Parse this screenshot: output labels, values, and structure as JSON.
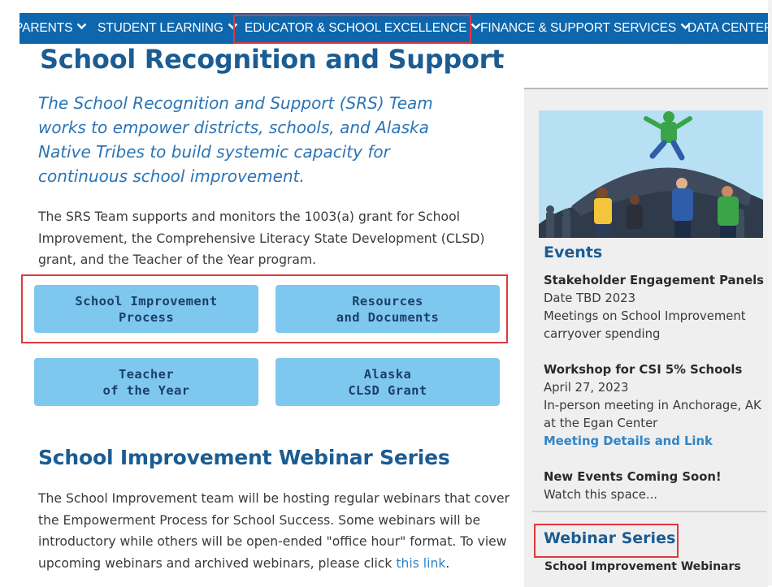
{
  "nav": {
    "items": [
      {
        "label": "PARENTS"
      },
      {
        "label": "STUDENT LEARNING"
      },
      {
        "label": "EDUCATOR & SCHOOL EXCELLENCE"
      },
      {
        "label": "FINANCE & SUPPORT SERVICES"
      },
      {
        "label": "DATA CENTER"
      }
    ]
  },
  "main": {
    "title": "School Recognition and Support",
    "lead": "The School Recognition and Support (SRS) Team works to empower districts, schools, and Alaska Native Tribes to build systemic capacity for continuous school improvement.",
    "body": "The SRS Team supports and monitors the 1003(a) grant for School Improvement, the Comprehensive Literacy State Development (CLSD) grant, and the Teacher of the Year program.",
    "tiles": [
      {
        "line1": "School Improvement",
        "line2": "Process"
      },
      {
        "line1": "Resources",
        "line2": "and Documents"
      },
      {
        "line1": "Teacher",
        "line2": "of the Year"
      },
      {
        "line1": "Alaska",
        "line2": "CLSD Grant"
      }
    ],
    "webinar_heading": "School Improvement Webinar Series",
    "webinar_text": "The School Improvement team will be hosting regular webinars that cover the Empowerment Process for School Success. Some webinars will be introductory while others will be open-ended \"office hour\" format. To view upcoming webinars and archived webinars, please click",
    "webinar_link": "this link",
    "webinar_end": "."
  },
  "sidebar": {
    "events_title": "Events",
    "events": [
      {
        "title": "Stakeholder Engagement Panels",
        "date": "Date TBD 2023",
        "desc": "Meetings on School Improvement carryover spending",
        "link": ""
      },
      {
        "title": "Workshop for CSI 5% Schools",
        "date": "April 27, 2023",
        "desc": "In-person meeting in Anchorage, AK at the Egan Center",
        "link": "Meeting Details and Link"
      },
      {
        "title": "New Events Coming Soon!",
        "date": "",
        "desc": "Watch this space...",
        "link": ""
      }
    ],
    "webinar_series_title": "Webinar Series",
    "webinar_series_sub": "School Improvement Webinars"
  },
  "colors": {
    "nav_bg": "#0e67ad",
    "heading": "#1b5c92",
    "lead_text": "#2b74b5",
    "tile_bg": "#7ec8f0",
    "highlight": "#e0393e",
    "link": "#2f84c6"
  },
  "icons": [
    "chevron-down-icon"
  ]
}
